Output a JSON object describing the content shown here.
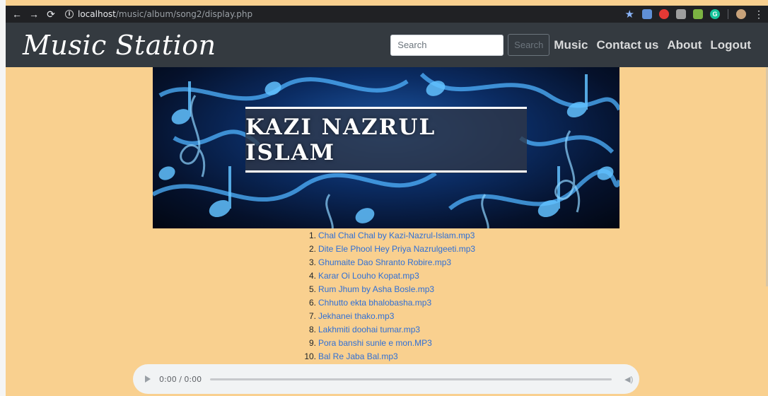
{
  "browser": {
    "url_host": "localhost",
    "url_path": "/music/album/song2/display.php"
  },
  "navbar": {
    "brand": "Music Station",
    "search_placeholder": "Search",
    "search_button": "Search",
    "links": [
      "Music",
      "Contact us",
      "About",
      "Logout"
    ]
  },
  "banner": {
    "title": "KAZI NAZRUL ISLAM"
  },
  "songs": [
    {
      "num": "1.",
      "title": "Chal Chal Chal by Kazi-Nazrul-Islam.mp3"
    },
    {
      "num": "2.",
      "title": "Dite Ele Phool Hey Priya Nazrulgeeti.mp3"
    },
    {
      "num": "3.",
      "title": "Ghumaite Dao Shranto Robire.mp3"
    },
    {
      "num": "4.",
      "title": "Karar Oi Louho Kopat.mp3"
    },
    {
      "num": "5.",
      "title": "Rum Jhum by Asha Bosle.mp3"
    },
    {
      "num": "6.",
      "title": "Chhutto ekta bhalobasha.mp3"
    },
    {
      "num": "7.",
      "title": "Jekhanei thako.mp3"
    },
    {
      "num": "8.",
      "title": "Lakhmiti doohai tumar.mp3"
    },
    {
      "num": "9.",
      "title": "Pora banshi sunle e mon.MP3"
    },
    {
      "num": "10.",
      "title": "Bal Re Jaba Bal.mp3"
    }
  ],
  "player": {
    "time": "0:00 / 0:00"
  },
  "colors": {
    "page_background": "#f9d08f",
    "navbar": "#343a40",
    "link": "#2f6fd6"
  }
}
